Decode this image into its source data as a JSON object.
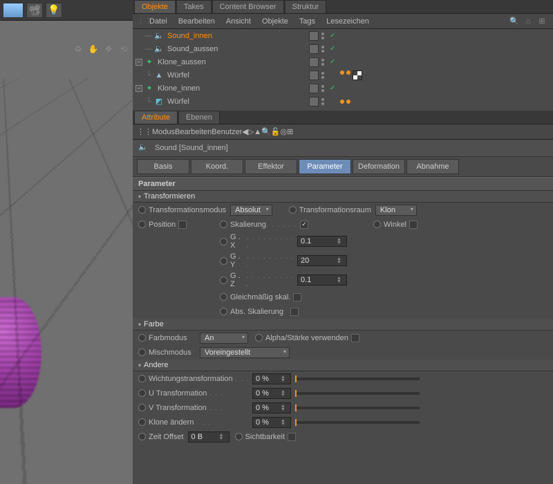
{
  "top_tabs": {
    "items": [
      "Objekte",
      "Takes",
      "Content Browser",
      "Struktur"
    ],
    "active": 0
  },
  "obj_menu": [
    "Datei",
    "Bearbeiten",
    "Ansicht",
    "Objekte",
    "Tags",
    "Lesezeichen"
  ],
  "tree": [
    {
      "name": "Sound_innen",
      "icon": "sound",
      "depth": 0,
      "exp": null,
      "sel": true,
      "tags": [
        "layer",
        "dots",
        "check"
      ]
    },
    {
      "name": "Sound_aussen",
      "icon": "sound",
      "depth": 0,
      "exp": null,
      "sel": false,
      "tags": [
        "layer",
        "dots",
        "check"
      ]
    },
    {
      "name": "Klone_aussen",
      "icon": "cloner",
      "depth": 0,
      "exp": "-",
      "sel": false,
      "tags": [
        "layer",
        "dots",
        "check"
      ]
    },
    {
      "name": "Würfel",
      "icon": "cube1",
      "depth": 1,
      "exp": null,
      "sel": false,
      "tags": [
        "layer",
        "dots"
      ],
      "extra": [
        "orange",
        "orange",
        "tex"
      ]
    },
    {
      "name": "Klone_innen",
      "icon": "cloner",
      "depth": 0,
      "exp": "-",
      "sel": false,
      "tags": [
        "layer",
        "dots",
        "check"
      ]
    },
    {
      "name": "Würfel",
      "icon": "cube2",
      "depth": 1,
      "exp": null,
      "sel": false,
      "tags": [
        "layer",
        "dots"
      ],
      "extra": [
        "orange",
        "orange"
      ]
    }
  ],
  "attr_tabs": {
    "items": [
      "Attribute",
      "Ebenen"
    ],
    "active": 0
  },
  "attr_menu": [
    "Modus",
    "Bearbeiten",
    "Benutzer"
  ],
  "obj_header": "Sound [Sound_innen]",
  "param_tabs": {
    "items": [
      "Basis",
      "Koord.",
      "Effektor",
      "Parameter",
      "Deformation",
      "Abnahme"
    ],
    "active": 3
  },
  "group_title": "Parameter",
  "sections": {
    "transform": {
      "title": "Transformieren",
      "mode_label": "Transformationsmodus",
      "mode_value": "Absolut",
      "space_label": "Transformationsraum",
      "space_value": "Klon",
      "position": "Position",
      "scale": "Skalierung",
      "angle": "Winkel",
      "gx": "G . X",
      "gx_v": "0.1",
      "gy": "G . Y",
      "gy_v": "20",
      "gz": "G . Z",
      "gz_v": "0.1",
      "uniform": "Gleichmäßig skal.",
      "abs": "Abs. Skalierung"
    },
    "color": {
      "title": "Farbe",
      "mode_label": "Farbmodus",
      "mode_value": "An",
      "alpha": "Alpha/Stärke verwenden",
      "blend_label": "Mischmodus",
      "blend_value": "Voreingestellt"
    },
    "other": {
      "title": "Andere",
      "rows": [
        {
          "label": "Wichtungstransformation",
          "value": "0 %"
        },
        {
          "label": "U Transformation",
          "value": "0 %"
        },
        {
          "label": "V Transformation",
          "value": "0 %"
        },
        {
          "label": "Klone ändern",
          "value": "0 %"
        }
      ],
      "time_label": "Zeit Offset",
      "time_value": "0 B",
      "vis": "Sichtbarkeit"
    }
  }
}
